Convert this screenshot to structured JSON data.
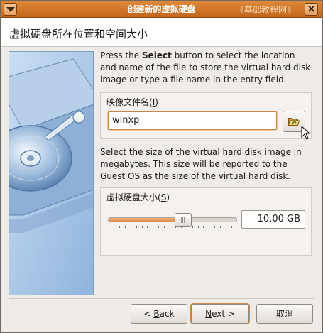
{
  "window": {
    "title": "创建新的虚拟硬盘",
    "watermark": "《基础教程网》"
  },
  "header": {
    "title": "虚拟硬盘所在位置和空间大小"
  },
  "content": {
    "location_desc_prefix": "Press the ",
    "location_desc_bold": "Select",
    "location_desc_suffix": " button to select the location and name of the file to store the virtual hard disk image or type a file name in the entry field.",
    "location_group_label_prefix": "映像文件名(",
    "location_group_label_key": "I",
    "location_group_label_suffix": ")",
    "file_name_value": "winxp",
    "size_desc": "Select the size of the virtual hard disk image in megabytes. This size will be reported to the Guest OS as the size of the virtual hard disk.",
    "size_group_label_prefix": "虚拟硬盘大小(",
    "size_group_label_key": "S",
    "size_group_label_suffix": ")",
    "size_value": "10.00 GB",
    "slider_fraction": 0.58
  },
  "buttons": {
    "back_prefix": "< ",
    "back_key": "B",
    "back_suffix": "ack",
    "next_key": "N",
    "next_suffix": "ext >",
    "cancel_label": "取消"
  },
  "colors": {
    "titlebar": "#c2661c",
    "accent": "#de8a45",
    "banner": "#a8c8ea"
  },
  "icons": {
    "window_menu": "triangle-down-icon",
    "close": "x-icon",
    "browse": "folder-open-icon",
    "cursor": "arrow-cursor-icon"
  }
}
